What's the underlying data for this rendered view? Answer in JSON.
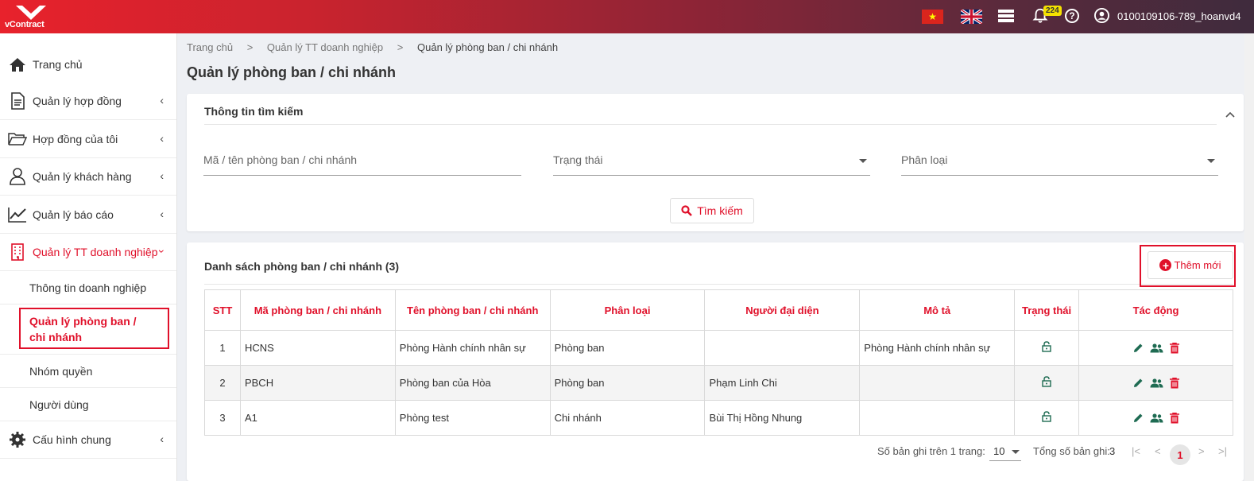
{
  "app": {
    "logo_text": "vContract"
  },
  "topbar": {
    "notifications_count": "224",
    "help_label": "?",
    "user_name": "0100109106-789_hoanvd4",
    "flag_vn_star": "★"
  },
  "sidebar": {
    "items": [
      {
        "label": "Trang chủ",
        "icon": "home-icon"
      },
      {
        "label": "Quản lý hợp đồng",
        "icon": "document-icon"
      },
      {
        "label": "Hợp đồng của tôi",
        "icon": "folder-icon"
      },
      {
        "label": "Quản lý khách hàng",
        "icon": "user-icon"
      },
      {
        "label": "Quản lý báo cáo",
        "icon": "chart-icon"
      },
      {
        "label": "Quản lý TT doanh nghiệp",
        "icon": "building-icon"
      },
      {
        "label": "Cấu hình chung",
        "icon": "gear-icon"
      }
    ],
    "subitems": [
      {
        "label": "Thông tin doanh nghiệp"
      },
      {
        "label": "Quản lý phòng ban / chi nhánh"
      },
      {
        "label": "Nhóm quyền"
      },
      {
        "label": "Người dùng"
      }
    ]
  },
  "breadcrumb": {
    "home": "Trang chủ",
    "sep": ">",
    "parent": "Quản lý TT doanh nghiệp",
    "current": "Quản lý phòng ban / chi nhánh"
  },
  "page": {
    "title": "Quản lý phòng ban / chi nhánh"
  },
  "search": {
    "title": "Thông tin tìm kiếm",
    "code_placeholder": "Mã / tên phòng ban / chi nhánh",
    "status_placeholder": "Trạng thái",
    "type_placeholder": "Phân loại",
    "button_label": "Tìm kiếm"
  },
  "list": {
    "title": "Danh sách phòng ban / chi nhánh (3)",
    "add_label": "Thêm mới",
    "columns": [
      "STT",
      "Mã phòng ban / chi nhánh",
      "Tên phòng ban / chi nhánh",
      "Phân loại",
      "Người đại diện",
      "Mô tả",
      "Trạng thái",
      "Tác động"
    ],
    "rows": [
      {
        "stt": "1",
        "code": "HCNS",
        "name": "Phòng Hành chính nhân sự",
        "type": "Phòng ban",
        "rep": "",
        "desc": "Phòng Hành chính nhân sự"
      },
      {
        "stt": "2",
        "code": "PBCH",
        "name": "Phòng ban của Hòa",
        "type": "Phòng ban",
        "rep": "Phạm Linh Chi",
        "desc": ""
      },
      {
        "stt": "3",
        "code": "A1",
        "name": "Phòng test",
        "type": "Chi nhánh",
        "rep": "Bùi Thị Hồng Nhung",
        "desc": ""
      }
    ]
  },
  "pagination": {
    "per_page_label": "Số bản ghi trên 1 trang:",
    "per_page_value": "10",
    "total_label": "Tổng số bản ghi:",
    "total_value": "3",
    "current_page": "1",
    "first": "|<",
    "prev": "<",
    "next": ">",
    "last": ">|"
  },
  "colors": {
    "accent": "#e0102a",
    "icon_green": "#1e6b52"
  }
}
